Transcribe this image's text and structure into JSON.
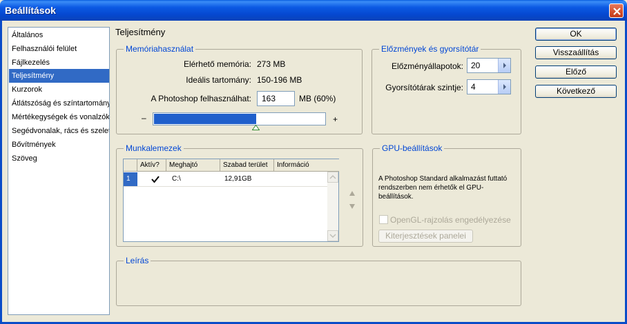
{
  "window": {
    "title": "Beállítások"
  },
  "sidebar": {
    "items": [
      {
        "label": "Általános"
      },
      {
        "label": "Felhasználói felület"
      },
      {
        "label": "Fájlkezelés"
      },
      {
        "label": "Teljesítmény",
        "selected": true
      },
      {
        "label": "Kurzorok"
      },
      {
        "label": "Átlátszóság és színtartomány"
      },
      {
        "label": "Mértékegységek és vonalzók"
      },
      {
        "label": "Segédvonalak, rács és szeletek"
      },
      {
        "label": "Bővítmények"
      },
      {
        "label": "Szöveg"
      }
    ]
  },
  "page_title": "Teljesítmény",
  "memory": {
    "legend": "Memóriahasználat",
    "available_label": "Elérhető memória:",
    "available_value": "273 MB",
    "ideal_label": "Ideális tartomány:",
    "ideal_value": "150-196 MB",
    "usable_label": "A Photoshop felhasználhat:",
    "usable_value": "163",
    "usable_unit": "MB (60%)",
    "slider_min": "–",
    "slider_max": "+",
    "slider_fraction": 0.6
  },
  "history": {
    "legend": "Előzmények és gyorsítótár",
    "states_label": "Előzményállapotok:",
    "states_value": "20",
    "cache_label": "Gyorsítótárak szintje:",
    "cache_value": "4"
  },
  "scratch": {
    "legend": "Munkalemezek",
    "headers": [
      "Aktív?",
      "Meghajtó",
      "Szabad terület",
      "Információ"
    ],
    "rows": [
      {
        "index": "1",
        "active": true,
        "drive": "C:\\",
        "free": "12,91GB",
        "info": ""
      }
    ]
  },
  "gpu": {
    "legend": "GPU-beállítások",
    "message": "A Photoshop Standard alkalmazást futtató rendszerben nem érhetők el GPU-beállítások.",
    "opengl_label": "OpenGL-rajzolás engedélyezése",
    "extensions_button": "Kiterjesztések panelei"
  },
  "description": {
    "legend": "Leírás"
  },
  "buttons": {
    "ok": "OK",
    "reset": "Visszaállítás",
    "prev": "Előző",
    "next": "Következő"
  },
  "colors": {
    "accent": "#316ac5",
    "legend": "#0046d5",
    "titlebar": "#0a5fe0"
  },
  "icons": [
    "close-icon",
    "arrow-right-icon",
    "arrow-up-icon",
    "arrow-down-icon",
    "slider-thumb-icon",
    "checkmark-icon"
  ]
}
